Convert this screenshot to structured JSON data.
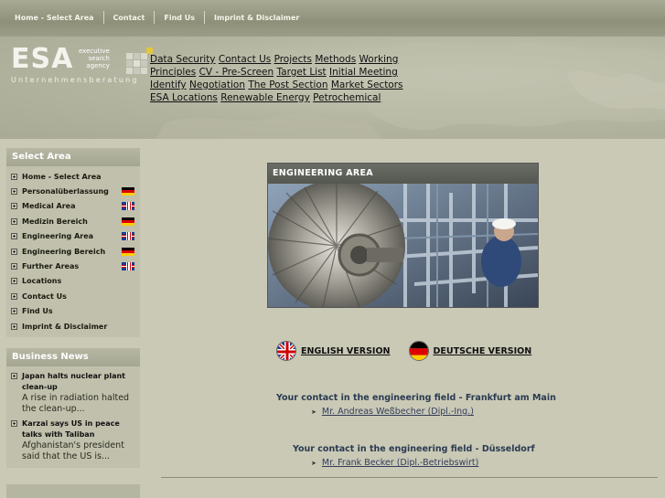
{
  "topnav": [
    "Home - Select Area",
    "Contact",
    "Find Us",
    "Imprint & Disclaimer"
  ],
  "logo": {
    "text": "ESA",
    "tagline1": "executive",
    "tagline2": "search",
    "tagline3": "agency",
    "subtitle": "Unternehmensberatung"
  },
  "header_links": [
    "Data Security",
    "Contact Us",
    "Projects",
    "Methods",
    "Working Principles",
    "CV - Pre-Screen",
    "Target List",
    "Initial Meeting",
    "Identify",
    "Negotiation",
    "The Post Section",
    "Market Sectors",
    "ESA Locations",
    "Renewable Energy",
    "Petrochemical"
  ],
  "sidebar": {
    "title": "Select Area",
    "items": [
      {
        "label": "Home - Select Area",
        "flag": ""
      },
      {
        "label": "Personalüberlassung",
        "flag": "de"
      },
      {
        "label": "Medical Area",
        "flag": "uk"
      },
      {
        "label": "Medizin Bereich",
        "flag": "de"
      },
      {
        "label": "Engineering Area",
        "flag": "uk"
      },
      {
        "label": "Engineering Bereich",
        "flag": "de"
      },
      {
        "label": "Further Areas",
        "flag": "uk"
      },
      {
        "label": "Locations",
        "flag": ""
      },
      {
        "label": "Contact Us",
        "flag": ""
      },
      {
        "label": "Find Us",
        "flag": ""
      },
      {
        "label": "Imprint & Disclaimer",
        "flag": ""
      }
    ]
  },
  "news": {
    "title": "Business News",
    "items": [
      {
        "headline": "Japan halts nuclear plant clean-up",
        "text": "A rise in radiation halted the clean-up..."
      },
      {
        "headline": "Karzai says US in peace talks with Taliban",
        "text": "Afghanistan's president said that the US is..."
      }
    ]
  },
  "banner": {
    "title": "ENGINEERING AREA"
  },
  "languages": {
    "english": "ENGLISH VERSION",
    "german": "DEUTSCHE VERSION"
  },
  "contacts": [
    {
      "heading": "Your contact in the engineering field - Frankfurt am Main",
      "person": "Mr. Andreas Weßbecher (Dipl.-Ing.)"
    },
    {
      "heading": "Your contact in the engineering field - Düsseldorf",
      "person": "Mr. Frank Becker (Dipl.-Betriebswirt)"
    }
  ],
  "colors": {
    "background": "#c9c9b6",
    "sidebar_header": "#a5a692",
    "contact_text": "#2a3a50"
  }
}
